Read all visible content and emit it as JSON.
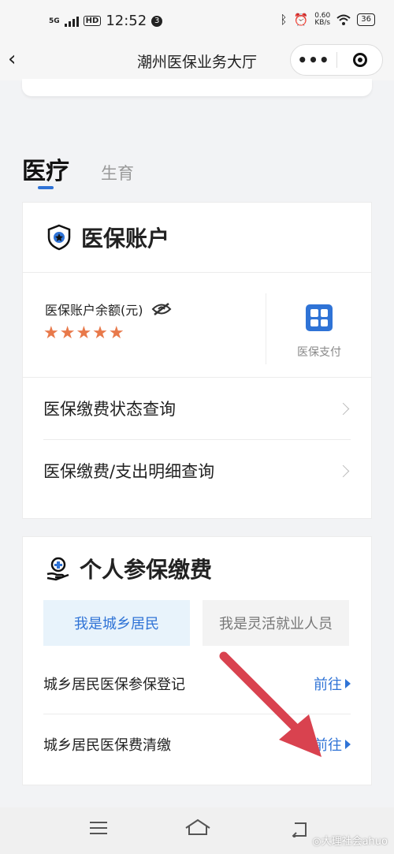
{
  "status_bar": {
    "network": "5G",
    "hd": "HD",
    "time": "12:52",
    "notification_count": "3",
    "speed_value": "0.60",
    "speed_unit": "KB/s",
    "battery": "36"
  },
  "nav": {
    "title": "潮州医保业务大厅",
    "more_label": "•••"
  },
  "tabs": [
    {
      "label": "医疗",
      "active": true
    },
    {
      "label": "生育",
      "active": false
    }
  ],
  "account_card": {
    "title": "医保账户",
    "balance_label": "医保账户余额(元)",
    "balance_masked": "★★★★★",
    "pay_label": "医保支付",
    "rows": [
      {
        "label": "医保缴费状态查询"
      },
      {
        "label": "医保缴费/支出明细查询"
      }
    ]
  },
  "personal_card": {
    "title": "个人参保缴费",
    "segments": [
      {
        "label": "我是城乡居民",
        "selected": true
      },
      {
        "label": "我是灵活就业人员",
        "selected": false
      }
    ],
    "rows": [
      {
        "label": "城乡居民医保参保登记",
        "action": "前往"
      },
      {
        "label": "城乡居民医保费清缴",
        "action": "前往"
      }
    ]
  },
  "watermark": "◎大理社会ahuo",
  "colors": {
    "accent": "#2f73d6",
    "stars": "#e8794a",
    "annotation_arrow": "#d9424f"
  }
}
